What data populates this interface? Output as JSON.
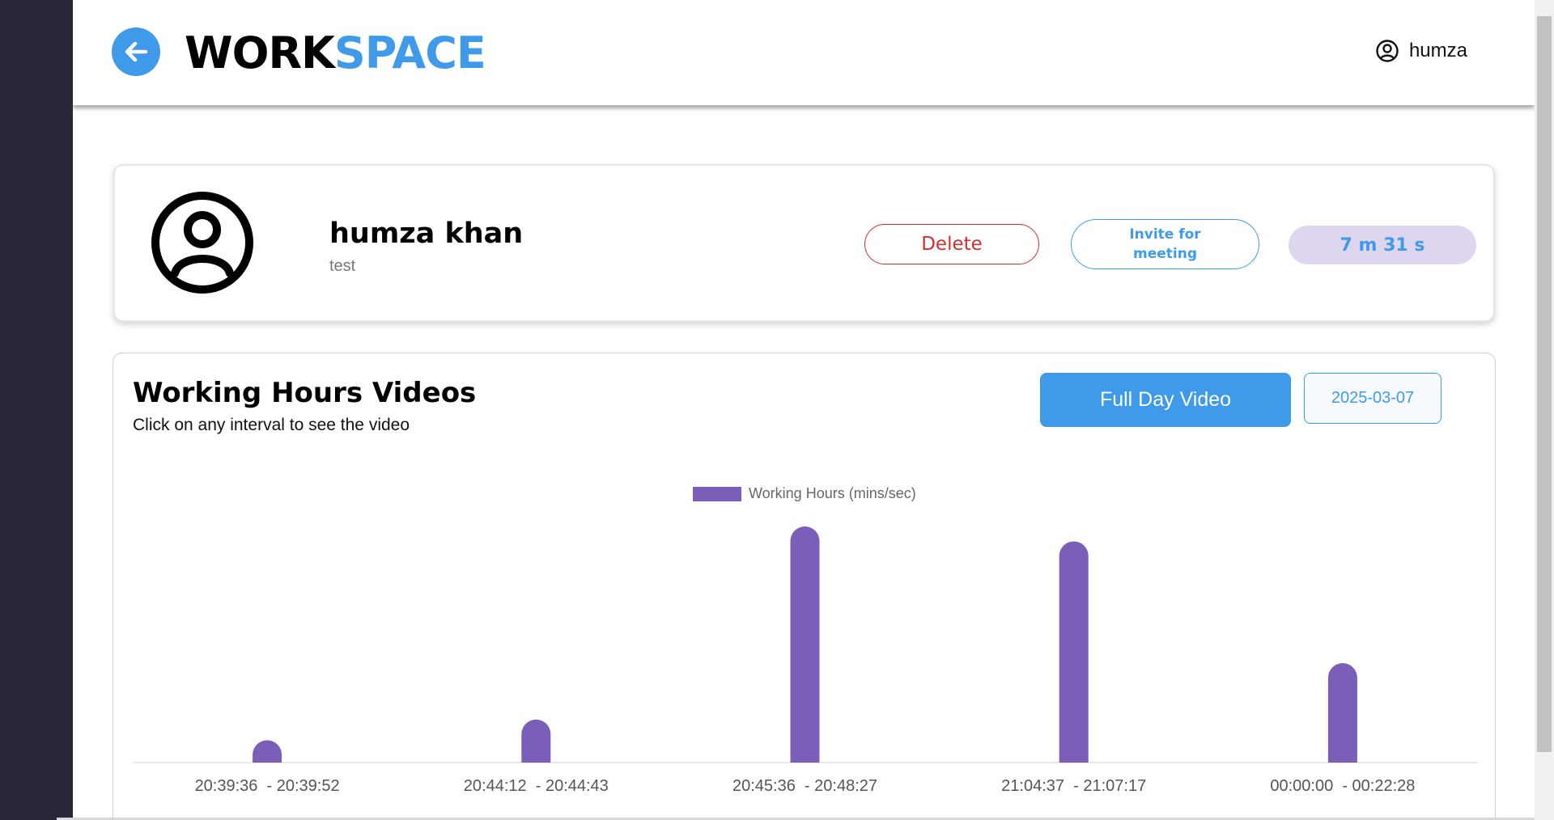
{
  "header": {
    "logo_part1": "WORK",
    "logo_part2": "SPACE",
    "username": "humza",
    "back_icon": "arrow-left-icon",
    "user_icon": "user-circle-icon"
  },
  "profile": {
    "name": "humza khan",
    "role": "test",
    "delete_label": "Delete",
    "invite_label": "Invite for meeting",
    "time_total": "7 m 31 s"
  },
  "videos": {
    "title": "Working Hours Videos",
    "subtitle": "Click on any interval to see the video",
    "full_day_label": "Full Day Video",
    "date_value": "2025-03-07"
  },
  "colors": {
    "accent": "#3f9ae9",
    "bar": "#7b5eb7",
    "danger": "#d32f2f",
    "sidebar": "#2a2538"
  },
  "chart_data": {
    "type": "bar",
    "legend": "Working Hours (mins/sec)",
    "legend_position": "top-center",
    "categories": [
      "20:39:36  - 20:39:52",
      "20:44:12  - 20:44:43",
      "20:45:36  - 20:48:27",
      "21:04:37  - 21:07:17",
      "00:00:00  - 00:22:28"
    ],
    "values": [
      0.27,
      0.52,
      2.85,
      2.67,
      1.2
    ],
    "ylim": [
      0,
      2.85
    ],
    "grid": false
  }
}
